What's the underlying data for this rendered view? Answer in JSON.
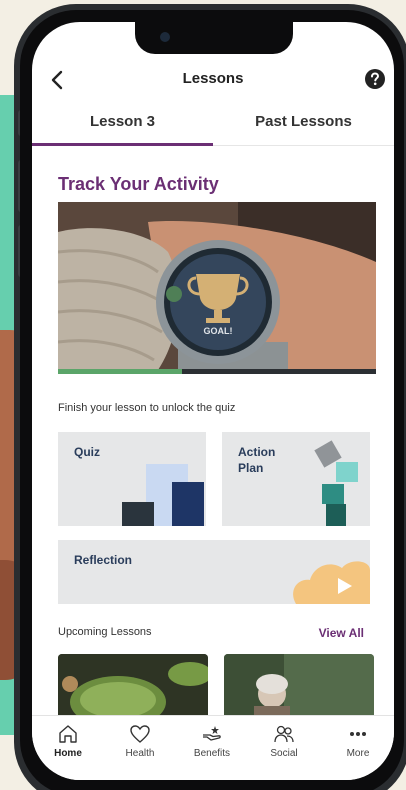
{
  "header": {
    "title": "Lessons"
  },
  "tabs": [
    {
      "label": "Lesson 3",
      "active": true
    },
    {
      "label": "Past Lessons",
      "active": false
    }
  ],
  "lesson": {
    "title": "Track Your Activity",
    "watch_text": "GOAL!",
    "video_progress": 0.39
  },
  "hint_text": "Finish your lesson to unlock the quiz",
  "cards": {
    "quiz": "Quiz",
    "action_line1": "Action",
    "action_line2": "Plan",
    "reflection": "Reflection"
  },
  "upcoming": {
    "label": "Upcoming Lessons",
    "view_all": "View All"
  },
  "bottom_nav": [
    {
      "label": "Home",
      "icon": "home-icon",
      "active": true
    },
    {
      "label": "Health",
      "icon": "heart-icon",
      "active": false
    },
    {
      "label": "Benefits",
      "icon": "benefits-hand-icon",
      "active": false
    },
    {
      "label": "Social",
      "icon": "people-icon",
      "active": false
    },
    {
      "label": "More",
      "icon": "more-dots-icon",
      "active": false
    }
  ],
  "colors": {
    "accent": "#6b2f74",
    "card_text": "#2a3d5b",
    "teal_background": "#66cfae",
    "progress": "#5ba569"
  }
}
